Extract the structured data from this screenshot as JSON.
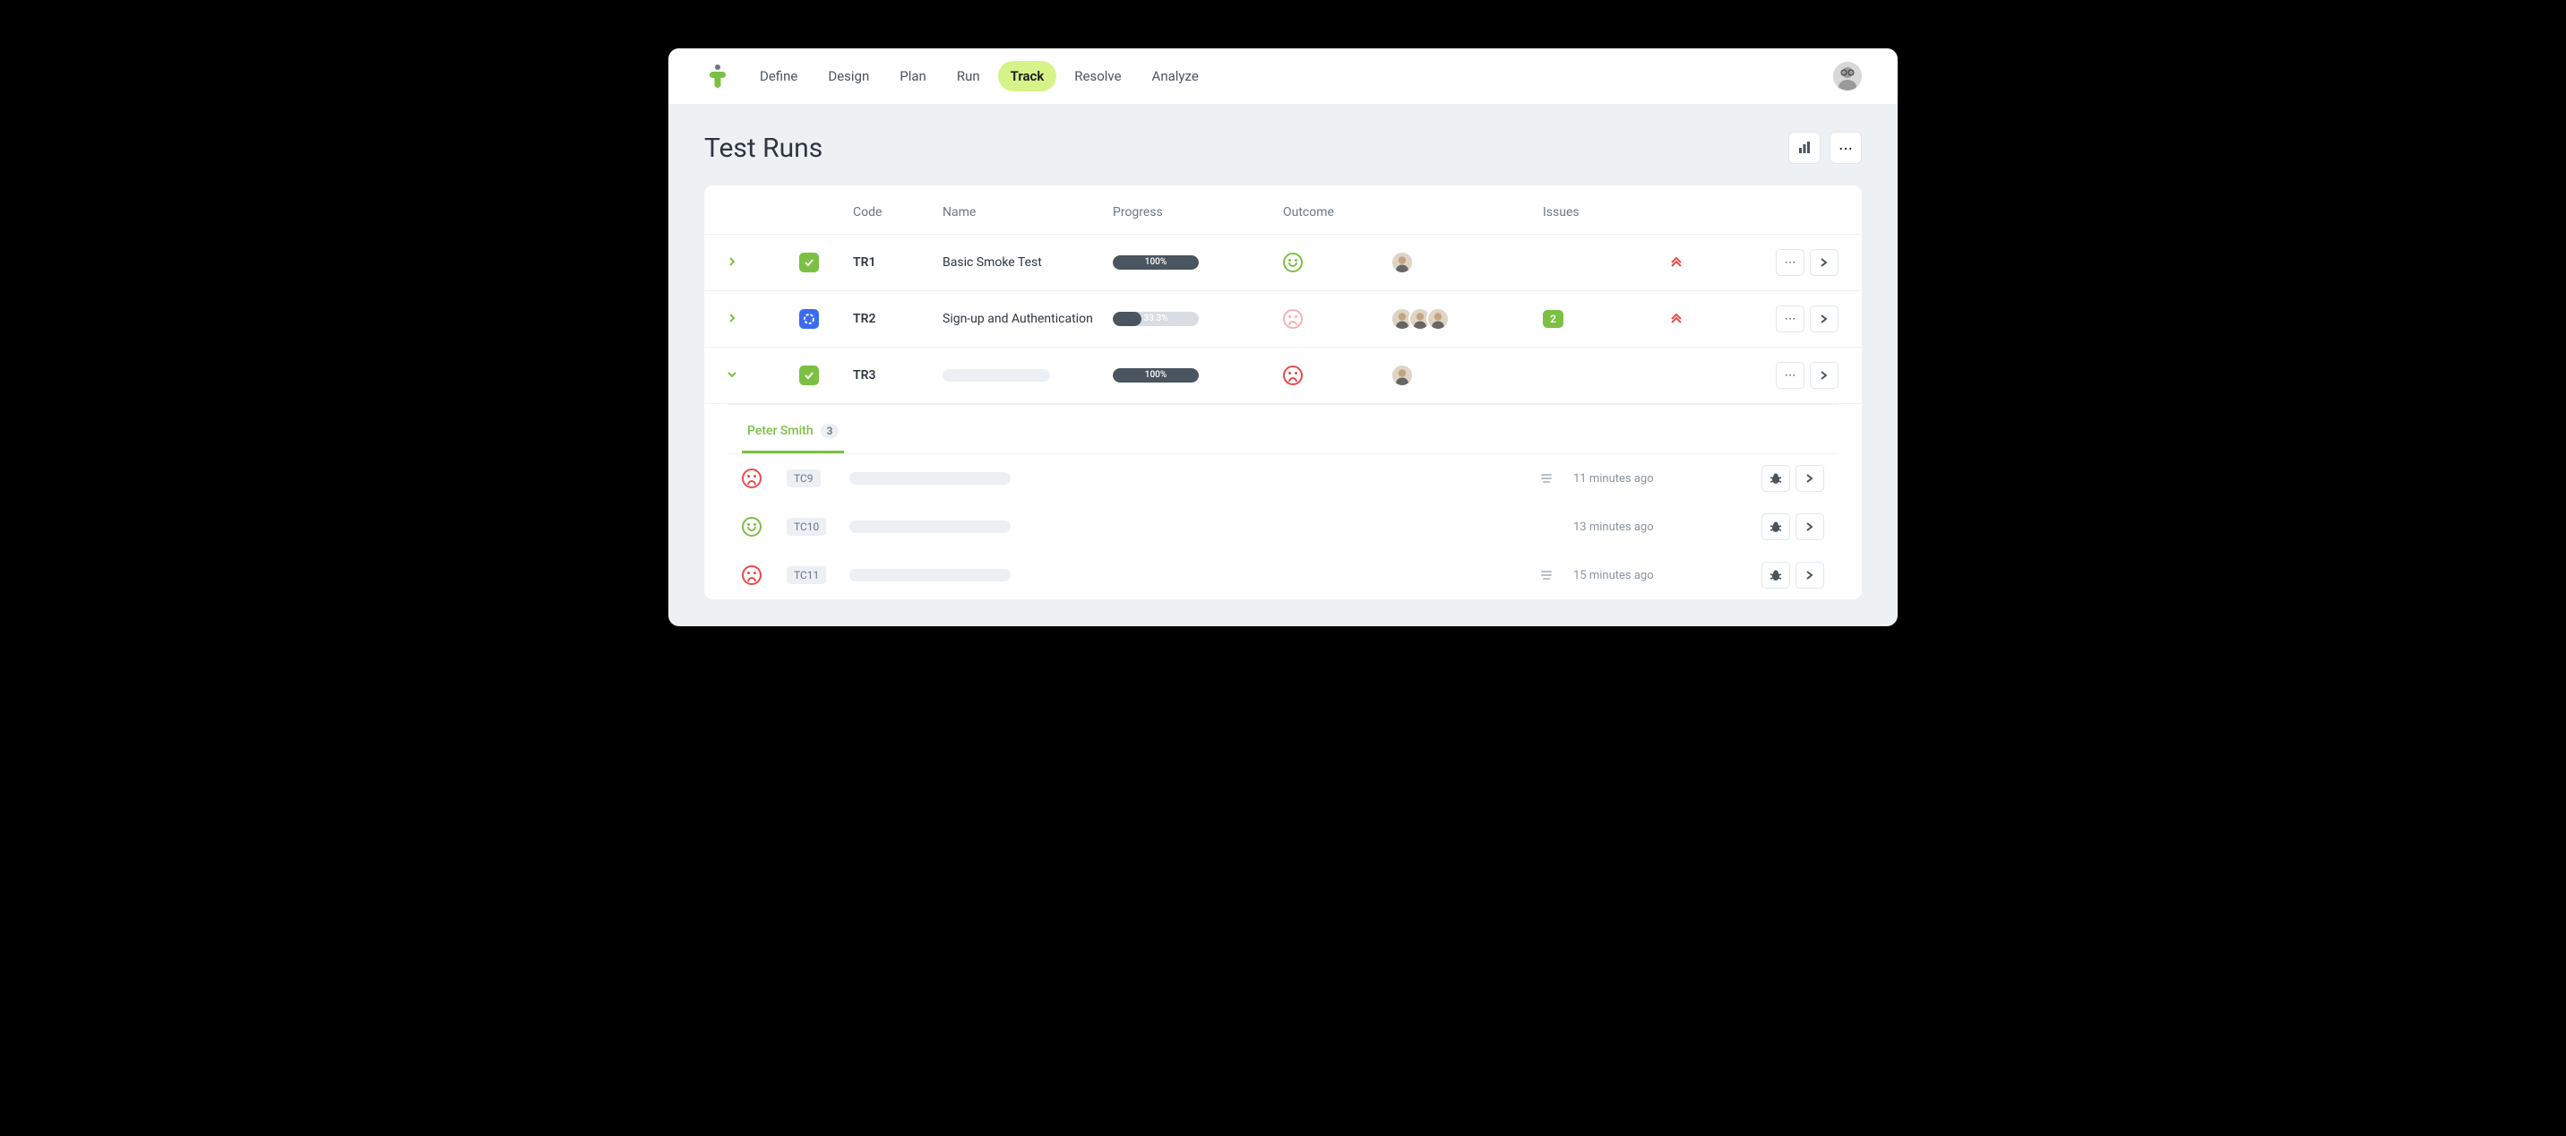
{
  "nav": {
    "items": [
      "Define",
      "Design",
      "Plan",
      "Run",
      "Track",
      "Resolve",
      "Analyze"
    ],
    "active": "Track"
  },
  "page": {
    "title": "Test Runs"
  },
  "table": {
    "headers": {
      "code": "Code",
      "name": "Name",
      "progress": "Progress",
      "outcome": "Outcome",
      "issues": "Issues"
    },
    "rows": [
      {
        "code": "TR1",
        "name": "Basic Smoke Test",
        "progress": "100%",
        "progressPct": 100,
        "outcome": "happy-green",
        "avatars": 1,
        "issues": null,
        "priority": true,
        "status": "green",
        "expanded": false,
        "chevron": "right"
      },
      {
        "code": "TR2",
        "name": "Sign-up and Authentication",
        "progress": "33.3%",
        "progressPct": 33.3,
        "outcome": "sad-pink",
        "avatars": 3,
        "issues": "2",
        "priority": true,
        "status": "blue",
        "expanded": false,
        "chevron": "right"
      },
      {
        "code": "TR3",
        "name": "",
        "progress": "100%",
        "progressPct": 100,
        "outcome": "sad-red",
        "avatars": 1,
        "issues": null,
        "priority": false,
        "status": "green",
        "expanded": true,
        "chevron": "down"
      }
    ]
  },
  "subpanel": {
    "tab": {
      "name": "Peter Smith",
      "count": "3"
    },
    "rows": [
      {
        "code": "TC9",
        "outcome": "sad-red",
        "hasLines": true,
        "time": "11 minutes ago"
      },
      {
        "code": "TC10",
        "outcome": "happy-green",
        "hasLines": false,
        "time": "13 minutes ago"
      },
      {
        "code": "TC11",
        "outcome": "sad-red",
        "hasLines": true,
        "time": "15 minutes ago"
      }
    ]
  }
}
